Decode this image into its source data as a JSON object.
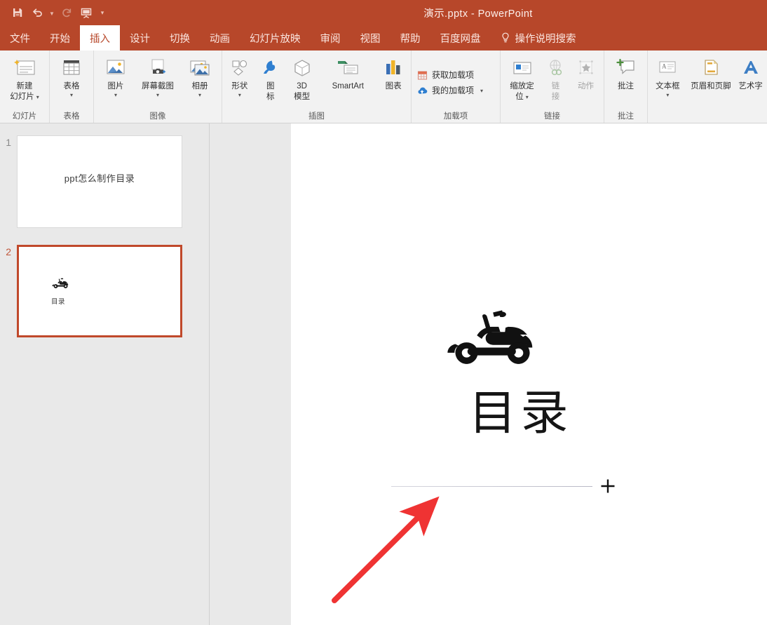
{
  "window": {
    "title": "演示.pptx  -  PowerPoint",
    "theme_color": "#b7472a",
    "accent_color": "#c0492b"
  },
  "quick_access": [
    {
      "name": "save-icon",
      "label": "保存"
    },
    {
      "name": "undo-icon",
      "label": "撤消"
    },
    {
      "name": "redo-icon",
      "label": "恢复"
    },
    {
      "name": "start-slideshow-icon",
      "label": "从头开始"
    },
    {
      "name": "customize-quick-access-icon",
      "label": "自定义快速访问工具栏"
    }
  ],
  "tabs": [
    {
      "label": "文件",
      "active": false
    },
    {
      "label": "开始",
      "active": false
    },
    {
      "label": "插入",
      "active": true
    },
    {
      "label": "设计",
      "active": false
    },
    {
      "label": "切换",
      "active": false
    },
    {
      "label": "动画",
      "active": false
    },
    {
      "label": "幻灯片放映",
      "active": false
    },
    {
      "label": "审阅",
      "active": false
    },
    {
      "label": "视图",
      "active": false
    },
    {
      "label": "帮助",
      "active": false
    },
    {
      "label": "百度网盘",
      "active": false
    }
  ],
  "tell_me": {
    "label": "操作说明搜索",
    "icon": "lightbulb-icon"
  },
  "ribbon": {
    "groups": [
      {
        "label": "幻灯片",
        "items": [
          {
            "label": "新建\n幻灯片",
            "line1": "新建",
            "line2": "幻灯片",
            "icon": "new-slide-icon",
            "has_caret_inline": true,
            "disabled": false
          }
        ]
      },
      {
        "label": "表格",
        "items": [
          {
            "label": "表格",
            "icon": "table-icon",
            "has_caret": true,
            "disabled": false
          }
        ]
      },
      {
        "label": "图像",
        "items": [
          {
            "label": "图片",
            "icon": "picture-icon",
            "has_caret": true,
            "disabled": false
          },
          {
            "label": "屏幕截图",
            "icon": "screenshot-icon",
            "has_caret": true,
            "disabled": false
          },
          {
            "label": "相册",
            "icon": "photo-album-icon",
            "has_caret": true,
            "disabled": false
          }
        ]
      },
      {
        "label": "插图",
        "items": [
          {
            "label": "形状",
            "icon": "shapes-icon",
            "has_caret": true,
            "disabled": false
          },
          {
            "label": "图标",
            "line1": "图",
            "line2": "标",
            "icon": "icons-icon",
            "disabled": false
          },
          {
            "label": "3D模型",
            "line1": "3D",
            "line2": "模型",
            "icon": "3d-model-icon",
            "disabled": false
          },
          {
            "label": "SmartArt",
            "icon": "smartart-icon",
            "disabled": false
          },
          {
            "label": "图表",
            "icon": "chart-icon",
            "disabled": false
          }
        ]
      },
      {
        "label": "加载项",
        "items": [
          {
            "label": "获取加载项",
            "icon": "get-addins-icon",
            "disabled": false
          },
          {
            "label": "我的加载项",
            "icon": "my-addins-icon",
            "has_caret_inline": true,
            "disabled": false
          }
        ]
      },
      {
        "label": "链接",
        "items": [
          {
            "label": "缩放定位",
            "line1": "缩放定",
            "line2": "位",
            "icon": "zoom-locate-icon",
            "has_caret_inline": true,
            "disabled": false
          },
          {
            "label": "链接",
            "line1": "链",
            "line2": "接",
            "icon": "link-icon",
            "disabled": true
          },
          {
            "label": "动作",
            "icon": "action-icon",
            "disabled": true
          }
        ]
      },
      {
        "label": "批注",
        "items": [
          {
            "label": "批注",
            "icon": "new-comment-icon",
            "disabled": false
          }
        ]
      },
      {
        "label": "",
        "items": [
          {
            "label": "文本框",
            "icon": "text-box-icon",
            "has_caret": true,
            "disabled": false
          },
          {
            "label": "页眉和页脚",
            "icon": "header-footer-icon",
            "disabled": false
          },
          {
            "label": "艺术字",
            "icon": "wordart-icon",
            "disabled": false
          }
        ]
      }
    ]
  },
  "thumbnails": [
    {
      "number": "1",
      "title": "ppt怎么制作目录",
      "selected": false
    },
    {
      "number": "2",
      "title": "目录",
      "selected": true,
      "icon": "scooter-icon"
    }
  ],
  "slide": {
    "icon": "scooter-icon",
    "title": "目录",
    "has_divider_line": true,
    "cursor": "crosshair-cursor",
    "annotation": {
      "name": "red-arrow-annotation",
      "color": "#ef3333"
    }
  }
}
